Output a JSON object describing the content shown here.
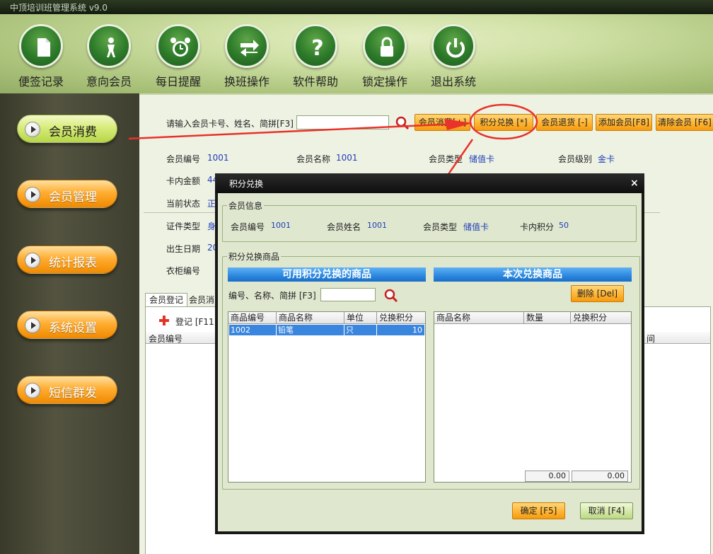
{
  "window": {
    "title": "中顶培训班管理系统  v9.0"
  },
  "toolbar": [
    {
      "id": "notes",
      "label": "便签记录",
      "icon": "notepad-icon"
    },
    {
      "id": "prospect",
      "label": "意向会员",
      "icon": "person-icon"
    },
    {
      "id": "reminder",
      "label": "每日提醒",
      "icon": "alarm-clock-icon"
    },
    {
      "id": "shift",
      "label": "换班操作",
      "icon": "swap-arrows-icon"
    },
    {
      "id": "help",
      "label": "软件帮助",
      "icon": "question-icon"
    },
    {
      "id": "lock",
      "label": "锁定操作",
      "icon": "lock-icon"
    },
    {
      "id": "exit",
      "label": "退出系统",
      "icon": "power-icon"
    }
  ],
  "sidebar": {
    "items": [
      {
        "label": "会员消费",
        "active": true
      },
      {
        "label": "会员管理"
      },
      {
        "label": "统计报表"
      },
      {
        "label": "系统设置"
      },
      {
        "label": "短信群发"
      }
    ]
  },
  "search": {
    "label": "请输入会员卡号、姓名、简拼[F3]",
    "value": ""
  },
  "actions": {
    "consume": "会员消费[+]",
    "exchange": "积分兑换 [*]",
    "return": "会员退货 [-]",
    "add": "添加会员[F8]",
    "clear": "清除会员 [F6]"
  },
  "member": {
    "id_label": "会员编号",
    "id_value": "1001",
    "name_label": "会员名称",
    "name_value": "1001",
    "type_label": "会员类型",
    "type_value": "储值卡",
    "level_label": "会员级别",
    "level_value": "金卡",
    "balance_label": "卡内金额",
    "balance_value": "44",
    "status_label": "当前状态",
    "status_value": "正",
    "cert_label": "证件类型",
    "cert_value": "身",
    "birth_label": "出生日期",
    "birth_value": "20",
    "locker_label": "衣柜编号"
  },
  "lower": {
    "tab1": "会员登记",
    "tab2": "会员消",
    "register_label": "登记 [F11",
    "col_member_id": "会员编号",
    "col_time": "间"
  },
  "dialog": {
    "title": "积分兑换",
    "close": "×",
    "info_legend": "会员信息",
    "info": {
      "id_label": "会员编号",
      "id_value": "1001",
      "name_label": "会员姓名",
      "name_value": "1001",
      "type_label": "会员类型",
      "type_value": "储值卡",
      "points_label": "卡内积分",
      "points_value": "50"
    },
    "goods_legend": "积分兑换商品",
    "left_title": "可用积分兑换的商品",
    "right_title": "本次兑换商品",
    "search_label": "编号、名称、简拼 [F3]",
    "search_value": "",
    "delete_button": "删除 [Del]",
    "left_columns": [
      "商品编号",
      "商品名称",
      "单位",
      "兑换积分"
    ],
    "left_rows": [
      {
        "code": "1002",
        "name": "铅笔",
        "unit": "只",
        "points": "10"
      }
    ],
    "right_columns": [
      "商品名称",
      "数量",
      "兑换积分"
    ],
    "totals": {
      "qty": "0.00",
      "points": "0.00"
    },
    "ok_button": "确定 [F5]",
    "cancel_button": "取消 [F4]"
  },
  "colors": {
    "annotation": "#e8322a",
    "accent_orange": "#ffb534",
    "value_blue": "#1f3db8",
    "grid_select": "#3a86de"
  }
}
